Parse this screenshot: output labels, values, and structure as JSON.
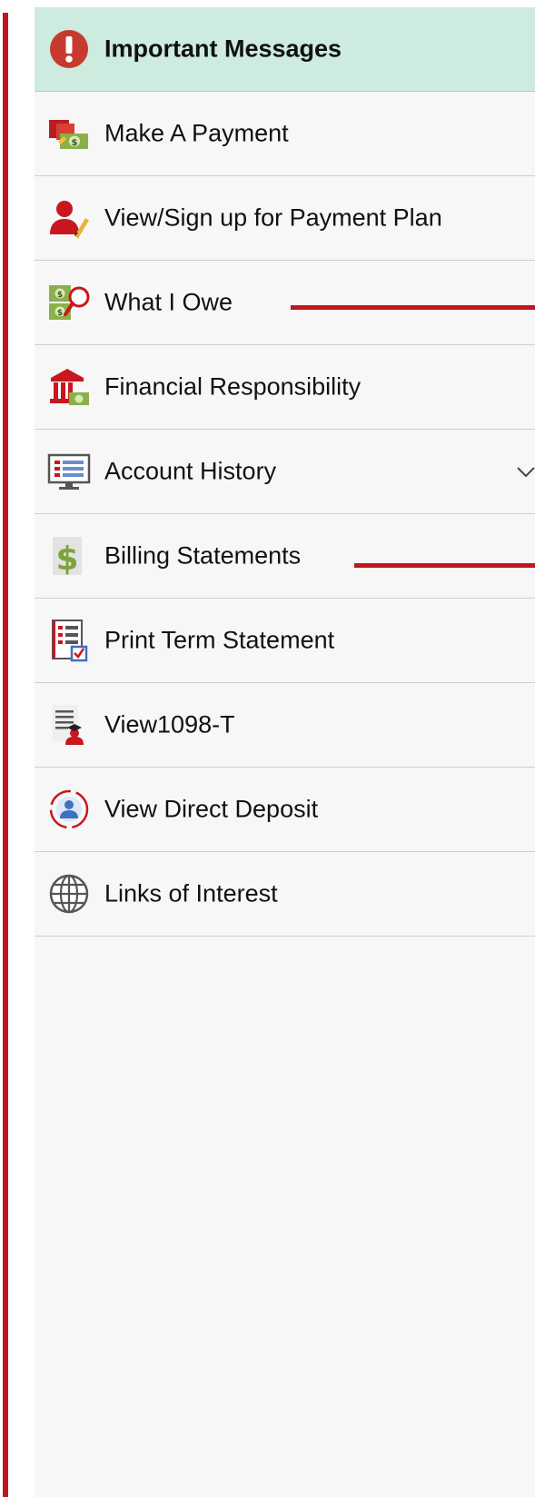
{
  "nav": {
    "items": [
      {
        "label": "Important Messages",
        "icon": "alert-icon",
        "active": true
      },
      {
        "label": "Make A Payment",
        "icon": "payment-icon"
      },
      {
        "label": "View/Sign up for Payment Plan",
        "icon": "user-pen-icon"
      },
      {
        "label": "What I Owe",
        "icon": "money-magnifier-icon"
      },
      {
        "label": "Financial Responsibility",
        "icon": "bank-icon"
      },
      {
        "label": "Account History",
        "icon": "monitor-list-icon",
        "has_dropdown": true
      },
      {
        "label": "Billing Statements",
        "icon": "dollar-icon"
      },
      {
        "label": "Print Term Statement",
        "icon": "statement-icon"
      },
      {
        "label": "View1098-T",
        "icon": "tax-form-icon"
      },
      {
        "label": "View Direct Deposit",
        "icon": "direct-deposit-icon"
      },
      {
        "label": "Links of Interest",
        "icon": "globe-icon"
      }
    ]
  },
  "colors": {
    "accent_red": "#c0171c",
    "active_bg": "#cdebdf",
    "panel_bg": "#f7f7f7",
    "divider": "#cfcfcf"
  }
}
